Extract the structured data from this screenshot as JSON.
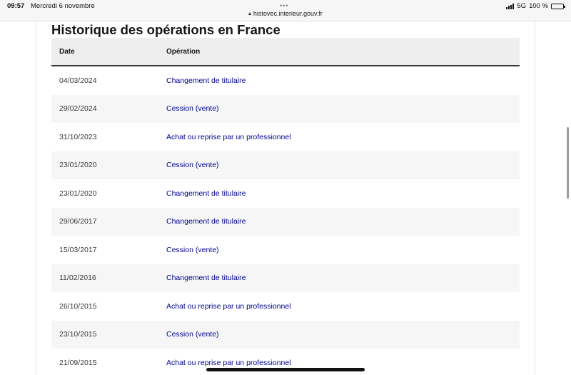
{
  "statusbar": {
    "time": "09:57",
    "date": "Mercredi 6 novembre",
    "dots": "•••",
    "url": "histovec.interieur.gouv.fr",
    "network": "5G",
    "battery": "100 %",
    "battery_level": 1.0
  },
  "page": {
    "title": "Historique des opérations en France"
  },
  "table": {
    "headers": {
      "date": "Date",
      "operation": "Opération"
    },
    "rows": [
      {
        "date": "04/03/2024",
        "operation": "Changement de titulaire"
      },
      {
        "date": "29/02/2024",
        "operation": "Cession (vente)"
      },
      {
        "date": "31/10/2023",
        "operation": "Achat ou reprise par un professionnel"
      },
      {
        "date": "23/01/2020",
        "operation": "Cession (vente)"
      },
      {
        "date": "23/01/2020",
        "operation": "Changement de titulaire"
      },
      {
        "date": "29/06/2017",
        "operation": "Changement de titulaire"
      },
      {
        "date": "15/03/2017",
        "operation": "Cession (vente)"
      },
      {
        "date": "11/02/2016",
        "operation": "Changement de titulaire"
      },
      {
        "date": "26/10/2015",
        "operation": "Achat ou reprise par un professionnel"
      },
      {
        "date": "23/10/2015",
        "operation": "Cession (vente)"
      },
      {
        "date": "21/09/2015",
        "operation": "Achat ou reprise par un professionnel"
      }
    ]
  }
}
